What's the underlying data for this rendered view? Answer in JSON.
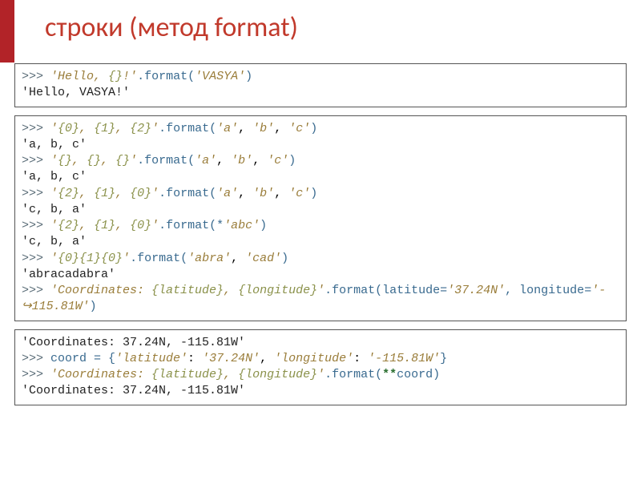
{
  "title": "строки (метод format)",
  "box1": {
    "l1_prompt": ">>> ",
    "l1_a": "'Hello, ",
    "l1_b": "{}",
    "l1_c": "!'",
    "l1_d": ".format(",
    "l1_e": "'VASYA'",
    "l1_f": ")",
    "l2": "'Hello, VASYA!'"
  },
  "box2": {
    "l1p": ">>> ",
    "l1a": "'",
    "l1b": "{0}",
    "l1c": ", ",
    "l1d": "{1}",
    "l1e": ", ",
    "l1f": "{2}",
    "l1g": "'",
    "l1h": ".format(",
    "l1i": "'a'",
    "l1j": ", ",
    "l1k": "'b'",
    "l1l": ", ",
    "l1m": "'c'",
    "l1n": ")",
    "l2": "'a, b, c'",
    "l3p": ">>> ",
    "l3a": "'",
    "l3b": "{}",
    "l3c": ", ",
    "l3d": "{}",
    "l3e": ", ",
    "l3f": "{}",
    "l3g": "'",
    "l3h": ".format(",
    "l3i": "'a'",
    "l3j": ", ",
    "l3k": "'b'",
    "l3l": ", ",
    "l3m": "'c'",
    "l3n": ")",
    "l4": "'a, b, c'",
    "l5p": ">>> ",
    "l5a": "'",
    "l5b": "{2}",
    "l5c": ", ",
    "l5d": "{1}",
    "l5e": ", ",
    "l5f": "{0}",
    "l5g": "'",
    "l5h": ".format(",
    "l5i": "'a'",
    "l5j": ", ",
    "l5k": "'b'",
    "l5l": ", ",
    "l5m": "'c'",
    "l5n": ")",
    "l6": "'c, b, a'",
    "l7p": ">>> ",
    "l7a": "'",
    "l7b": "{2}",
    "l7c": ", ",
    "l7d": "{1}",
    "l7e": ", ",
    "l7f": "{0}",
    "l7g": "'",
    "l7h": ".format(",
    "l7i": "*",
    "l7j": "'abc'",
    "l7k": ")",
    "l8": "'c, b, a'",
    "l9p": ">>> ",
    "l9a": "'",
    "l9b": "{0}{1}{0}",
    "l9c": "'",
    "l9d": ".format(",
    "l9e": "'abra'",
    "l9f": ", ",
    "l9g": "'cad'",
    "l9h": ")",
    "l10": "'abracadabra'",
    "l11p": ">>> ",
    "l11a": "'Coordinates: ",
    "l11b": "{latitude}",
    "l11c": ", ",
    "l11d": "{longitude}",
    "l11e": "'",
    "l11f": ".format(latitude=",
    "l11g": "'37.24N'",
    "l11h": ", longitude=",
    "l11i": "'-",
    "l12a": "↪115.81W'",
    "l12b": ")"
  },
  "box3": {
    "l1": "'Coordinates: 37.24N, -115.81W'",
    "l2p": ">>> ",
    "l2a": "coord = {",
    "l2b": "'latitude'",
    "l2c": ": ",
    "l2d": "'37.24N'",
    "l2e": ", ",
    "l2f": "'longitude'",
    "l2g": ": ",
    "l2h": "'-115.81W'",
    "l2i": "}",
    "l3p": ">>> ",
    "l3a": "'Coordinates: ",
    "l3b": "{latitude}",
    "l3c": ", ",
    "l3d": "{longitude}",
    "l3e": "'",
    "l3f": ".format(",
    "l3g": "**",
    "l3h": "coord)",
    "l4": "'Coordinates: 37.24N, -115.81W'"
  }
}
